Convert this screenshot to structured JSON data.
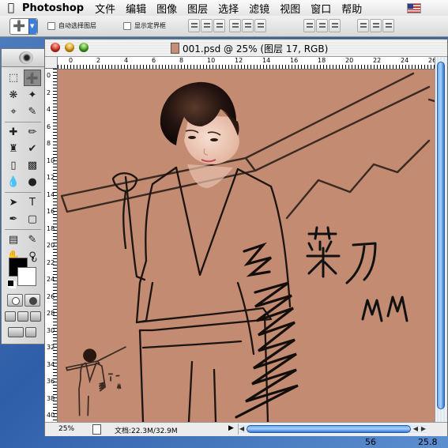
{
  "menubar": {
    "app_name": "Photoshop",
    "items": [
      "文件",
      "编辑",
      "图像",
      "图层",
      "选择",
      "滤镜",
      "视图",
      "窗口",
      "帮助"
    ]
  },
  "options_bar": {
    "auto_select_layer": "自动选择图层",
    "show_bounding_box": "显示定界框"
  },
  "document": {
    "title": "001.psd @ 25% (图层 17, RGB)",
    "zoom": "25%",
    "doc_info": "文档:22.3M/32.9M",
    "canvas_color": "#c28b72"
  },
  "rulers": {
    "top_labels": [
      "0",
      "2",
      "4",
      "6",
      "8",
      "10",
      "12",
      "14",
      "16",
      "18",
      "20",
      "22",
      "24",
      "26"
    ],
    "left_labels": [
      "0",
      "2",
      "4",
      "6",
      "8",
      "10",
      "12",
      "14",
      "16",
      "18",
      "20",
      "22",
      "24",
      "26",
      "28",
      "30",
      "32",
      "34",
      "36",
      "38",
      "40"
    ]
  },
  "artwork": {
    "title_text": "菜刀",
    "signature": "MM"
  },
  "info_readout": {
    "value_a": "56",
    "value_b": "25.8"
  },
  "colors": {
    "foreground": "#000000",
    "background": "#ffffff",
    "scroll_accent": "#3d7ed8"
  }
}
